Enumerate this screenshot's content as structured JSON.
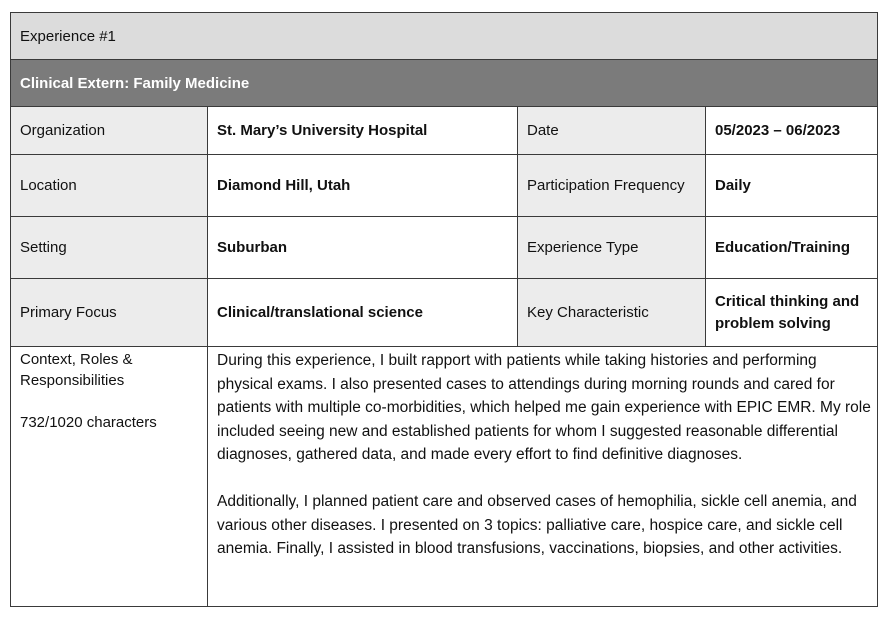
{
  "experience": {
    "title": "Experience #1",
    "subtitle": "Clinical Extern: Family Medicine"
  },
  "fields": {
    "organization": {
      "label": "Organization",
      "value": "St. Mary’s University Hospital"
    },
    "date": {
      "label": "Date",
      "value": "05/2023 – 06/2023"
    },
    "location": {
      "label": "Location",
      "value": "Diamond Hill, Utah"
    },
    "participation_frequency": {
      "label": "Participation Frequency",
      "value": "Daily"
    },
    "setting": {
      "label": "Setting",
      "value": "Suburban"
    },
    "experience_type": {
      "label": "Experience Type",
      "value": "Education/Training"
    },
    "primary_focus": {
      "label": "Primary Focus",
      "value": "Clinical/translational science"
    },
    "key_characteristic": {
      "label": "Key Characteristic",
      "value": "Critical thinking and problem solving"
    }
  },
  "context": {
    "label": "Context, Roles & Responsibilities",
    "character_count": "732/1020 characters",
    "paragraphs": [
      "During this experience, I built rapport with patients while taking histories and performing physical exams. I also presented cases to attendings during morning rounds and cared for patients with multiple co-morbidities, which helped me gain experience with EPIC EMR. My role included seeing new and established patients for whom I suggested reasonable differential diagnoses, gathered data, and made every effort to find definitive diagnoses.",
      "Additionally, I planned patient care and observed cases of hemophilia, sickle cell anemia, and various other diseases. I presented on 3 topics: palliative care, hospice care, and sickle cell anemia. Finally, I assisted in blood transfusions, vaccinations, biopsies, and other activities."
    ]
  },
  "colors": {
    "title_bg": "#dcdcdc",
    "subtitle_bg": "#7b7b7b",
    "label_bg": "#ececec",
    "border": "#3a3a3a"
  }
}
